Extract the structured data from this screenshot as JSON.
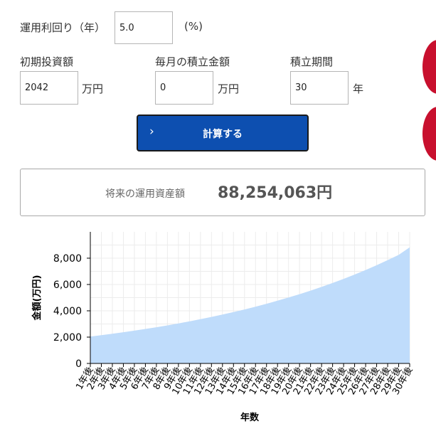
{
  "form": {
    "rate_label": "運用利回り（年）",
    "rate_value": "5.0",
    "rate_unit": "(%)",
    "initial_label": "初期投資額",
    "initial_value": "2042",
    "initial_unit": "万円",
    "monthly_label": "毎月の積立金額",
    "monthly_value": "0",
    "monthly_unit": "万円",
    "period_label": "積立期間",
    "period_value": "30",
    "period_unit": "年",
    "calc_button": "計算する",
    "calc_chevron": "›"
  },
  "result": {
    "label": "将来の運用資産額",
    "value": "88,254,063円"
  },
  "colors": {
    "button_bg": "#0d4fb0",
    "area_fill": "#bfdcfb",
    "decoration": "#c8102e"
  },
  "icons": {
    "button_icon": "chevron-right-icon"
  },
  "chart_data": {
    "type": "area",
    "xlabel": "年数",
    "ylabel": "金額(万円)",
    "ylim": [
      0,
      10000
    ],
    "yticks": [
      0,
      2000,
      4000,
      6000,
      8000
    ],
    "ytick_labels": [
      "0",
      "2,000",
      "4,000",
      "6,000",
      "8,000"
    ],
    "grid": true,
    "categories": [
      "1年後",
      "2年後",
      "3年後",
      "4年後",
      "5年後",
      "6年後",
      "7年後",
      "8年後",
      "9年後",
      "10年後",
      "11年後",
      "12年後",
      "13年後",
      "14年後",
      "15年後",
      "16年後",
      "17年後",
      "18年後",
      "19年後",
      "20年後",
      "21年後",
      "22年後",
      "23年後",
      "24年後",
      "25年後",
      "26年後",
      "27年後",
      "28年後",
      "29年後",
      "30年後"
    ],
    "values": [
      2042,
      2146,
      2256,
      2371,
      2492,
      2619,
      2753,
      2894,
      3042,
      3197,
      3361,
      3533,
      3713,
      3903,
      4103,
      4313,
      4533,
      4765,
      5009,
      5265,
      5534,
      5817,
      6115,
      6428,
      6756,
      7102,
      7465,
      7847,
      8248,
      8825
    ]
  }
}
